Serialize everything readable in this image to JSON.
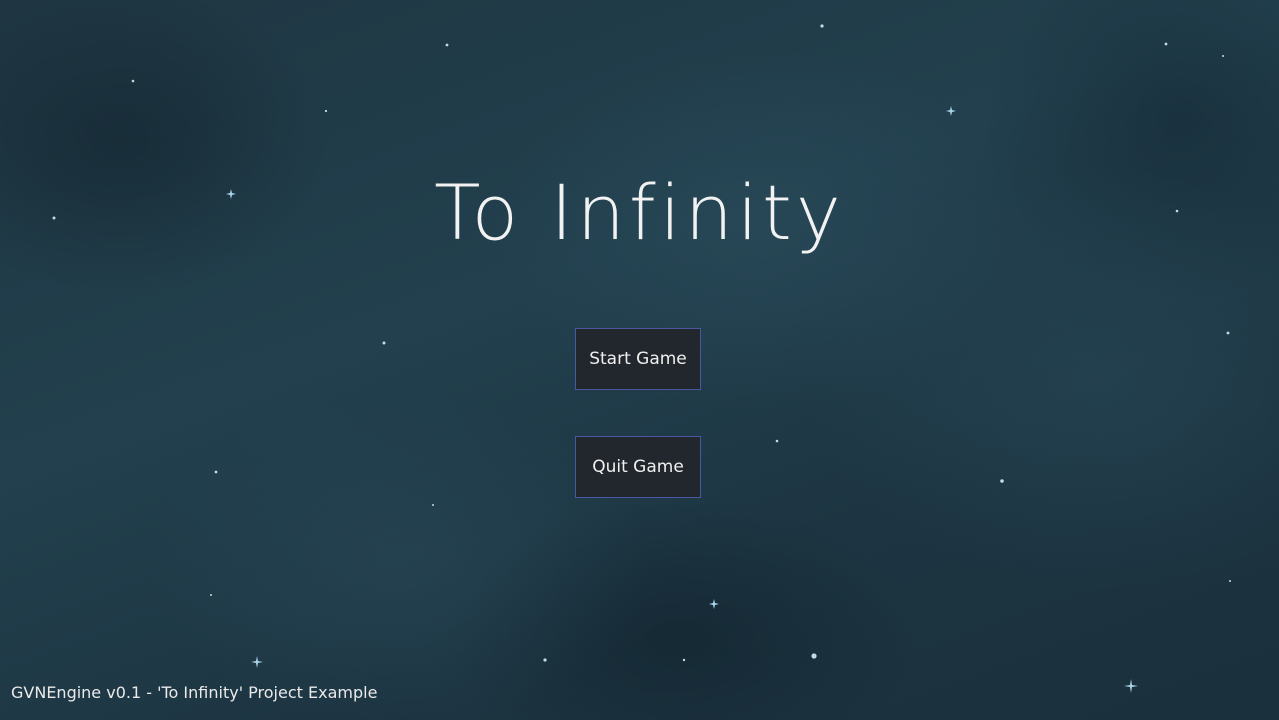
{
  "game": {
    "title": "To Infinity"
  },
  "menu": {
    "start_label": "Start Game",
    "quit_label": "Quit Game"
  },
  "footer": {
    "version_text": "GVNEngine v0.1 - 'To Infinity' Project Example"
  },
  "colors": {
    "background": "#1e3440",
    "button_fill": "#22262d",
    "button_border": "#4b57a0",
    "text": "#f0f0f0",
    "star": "#d8ecf4",
    "sparkle": "#a9d6ea"
  },
  "background_icons": "star-icon, sparkle-icon"
}
